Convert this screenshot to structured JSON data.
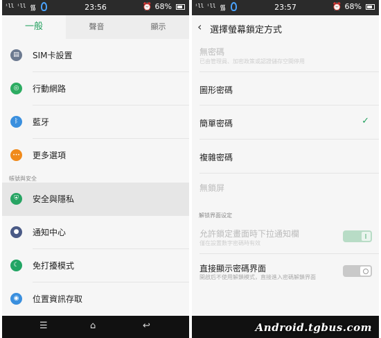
{
  "left": {
    "status": {
      "signal": "ⁱll ⁱll",
      "time": "23:56",
      "battery": "68%"
    },
    "tabs": [
      "一般",
      "聲音",
      "顯示"
    ],
    "items": [
      {
        "label": "SIM卡設置",
        "icon": "sim-card-icon",
        "color": "#6c7a90",
        "glyph": "▤"
      },
      {
        "label": "行動網路",
        "icon": "globe-icon",
        "color": "#2dac62",
        "glyph": "◎"
      },
      {
        "label": "藍牙",
        "icon": "bluetooth-icon",
        "color": "#3a8fde",
        "glyph": "ᛒ"
      },
      {
        "label": "更多選項",
        "icon": "more-icon",
        "color": "#f08a1c",
        "glyph": "•••"
      }
    ],
    "section": "帳號與安全",
    "items2": [
      {
        "label": "安全與隱私",
        "icon": "shield-icon",
        "color": "#27a463",
        "glyph": "⛨"
      },
      {
        "label": "通知中心",
        "icon": "notification-icon",
        "color": "#4a5a86",
        "glyph": "●"
      },
      {
        "label": "免打擾模式",
        "icon": "moon-icon",
        "color": "#22a564",
        "glyph": "☾"
      },
      {
        "label": "位置資訊存取",
        "icon": "location-icon",
        "color": "#3a8fde",
        "glyph": "◉"
      }
    ]
  },
  "right": {
    "status": {
      "signal": "ⁱll ⁱll",
      "time": "23:57",
      "battery": "68%"
    },
    "title": "選擇螢幕鎖定方式",
    "options": [
      {
        "title": "無密碼",
        "sub": "已由管理員、加密政策或認證儲存空間停用",
        "disabled": true
      },
      {
        "title": "圖形密碼"
      },
      {
        "title": "簡單密碼",
        "checked": true
      },
      {
        "title": "複雜密碼"
      },
      {
        "title": "無鎖屏",
        "disabled": true
      }
    ],
    "section": "解锁界面设定",
    "toggles": [
      {
        "title": "允許鎖定畫面時下拉通知欄",
        "sub": "僅在設置數字密碼時有效",
        "disabled": true,
        "state": "on"
      },
      {
        "title": "直接顯示密碼界面",
        "sub": "開啟后不使用解鎖模式，直接進入密碼解鎖界面",
        "state": "off"
      }
    ]
  },
  "watermark": "Android.tgbus.com",
  "accent": "#23a15f"
}
